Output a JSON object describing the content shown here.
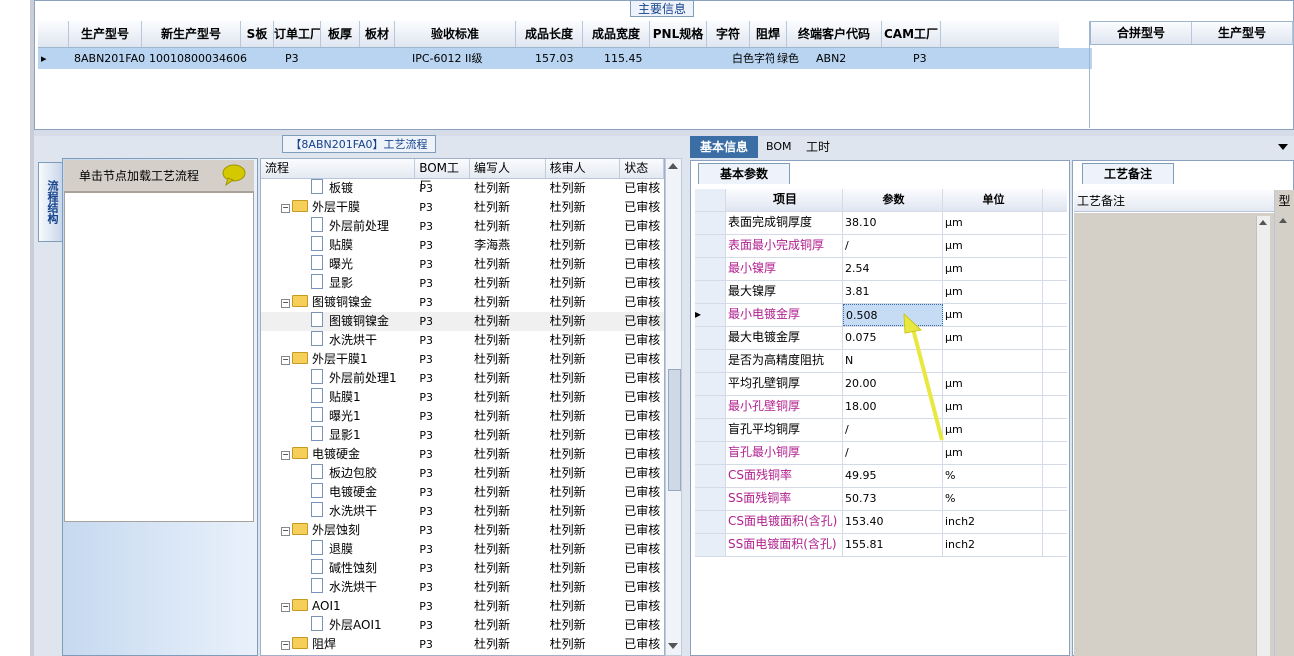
{
  "top_panel": {
    "title": "主要信息",
    "columns": [
      "生产型号",
      "新生产型号",
      "S板",
      "订单工厂",
      "板厚",
      "板材",
      "验收标准",
      "成品长度",
      "成品宽度",
      "PNL规格",
      "字符",
      "阻焊",
      "终端客户代码",
      "CAM工厂"
    ],
    "row": [
      "8ABN201FA0",
      "10010800034606",
      "",
      "P3",
      "",
      "",
      "IPC-6012 II级",
      "157.03",
      "115.45",
      "",
      "白色字符",
      "绿色",
      "ABN2",
      "P3"
    ],
    "right_columns": [
      "合拼型号",
      "生产型号"
    ]
  },
  "left_panel": {
    "tab_label": "流程结构",
    "header": "单击节点加载工艺流程"
  },
  "flow": {
    "title": "【8ABN201FA0】工艺流程",
    "columns": [
      "流程",
      "BOM工厂",
      "编写人",
      "核审人",
      "状态"
    ],
    "rows": [
      {
        "name": "板镀",
        "level": 2,
        "factory": "P3",
        "writer": "杜列新",
        "reviewer": "杜列新",
        "status": "已审核"
      },
      {
        "name": "外层干膜",
        "level": 1,
        "factory": "P3",
        "writer": "杜列新",
        "reviewer": "杜列新",
        "status": "已审核"
      },
      {
        "name": "外层前处理",
        "level": 2,
        "factory": "P3",
        "writer": "杜列新",
        "reviewer": "杜列新",
        "status": "已审核"
      },
      {
        "name": "贴膜",
        "level": 2,
        "factory": "P3",
        "writer": "李海燕",
        "reviewer": "杜列新",
        "status": "已审核"
      },
      {
        "name": "曝光",
        "level": 2,
        "factory": "P3",
        "writer": "杜列新",
        "reviewer": "杜列新",
        "status": "已审核"
      },
      {
        "name": "显影",
        "level": 2,
        "factory": "P3",
        "writer": "杜列新",
        "reviewer": "杜列新",
        "status": "已审核"
      },
      {
        "name": "图镀铜镍金",
        "level": 1,
        "factory": "P3",
        "writer": "杜列新",
        "reviewer": "杜列新",
        "status": "已审核"
      },
      {
        "name": "图镀铜镍金",
        "level": 2,
        "factory": "P3",
        "writer": "杜列新",
        "reviewer": "杜列新",
        "status": "已审核"
      },
      {
        "name": "水洗烘干",
        "level": 2,
        "factory": "P3",
        "writer": "杜列新",
        "reviewer": "杜列新",
        "status": "已审核"
      },
      {
        "name": "外层干膜1",
        "level": 1,
        "factory": "P3",
        "writer": "杜列新",
        "reviewer": "杜列新",
        "status": "已审核"
      },
      {
        "name": "外层前处理1",
        "level": 2,
        "factory": "P3",
        "writer": "杜列新",
        "reviewer": "杜列新",
        "status": "已审核"
      },
      {
        "name": "贴膜1",
        "level": 2,
        "factory": "P3",
        "writer": "杜列新",
        "reviewer": "杜列新",
        "status": "已审核"
      },
      {
        "name": "曝光1",
        "level": 2,
        "factory": "P3",
        "writer": "杜列新",
        "reviewer": "杜列新",
        "status": "已审核"
      },
      {
        "name": "显影1",
        "level": 2,
        "factory": "P3",
        "writer": "杜列新",
        "reviewer": "杜列新",
        "status": "已审核"
      },
      {
        "name": "电镀硬金",
        "level": 1,
        "factory": "P3",
        "writer": "杜列新",
        "reviewer": "杜列新",
        "status": "已审核"
      },
      {
        "name": "板边包胶",
        "level": 2,
        "factory": "P3",
        "writer": "杜列新",
        "reviewer": "杜列新",
        "status": "已审核"
      },
      {
        "name": "电镀硬金",
        "level": 2,
        "factory": "P3",
        "writer": "杜列新",
        "reviewer": "杜列新",
        "status": "已审核"
      },
      {
        "name": "水洗烘干",
        "level": 2,
        "factory": "P3",
        "writer": "杜列新",
        "reviewer": "杜列新",
        "status": "已审核"
      },
      {
        "name": "外层蚀刻",
        "level": 1,
        "factory": "P3",
        "writer": "杜列新",
        "reviewer": "杜列新",
        "status": "已审核"
      },
      {
        "name": "退膜",
        "level": 2,
        "factory": "P3",
        "writer": "杜列新",
        "reviewer": "杜列新",
        "status": "已审核"
      },
      {
        "name": "碱性蚀刻",
        "level": 2,
        "factory": "P3",
        "writer": "杜列新",
        "reviewer": "杜列新",
        "status": "已审核"
      },
      {
        "name": "水洗烘干",
        "level": 2,
        "factory": "P3",
        "writer": "杜列新",
        "reviewer": "杜列新",
        "status": "已审核"
      },
      {
        "name": "AOI1",
        "level": 1,
        "factory": "P3",
        "writer": "杜列新",
        "reviewer": "杜列新",
        "status": "已审核"
      },
      {
        "name": "外层AOI1",
        "level": 2,
        "factory": "P3",
        "writer": "杜列新",
        "reviewer": "杜列新",
        "status": "已审核"
      },
      {
        "name": "阻焊",
        "level": 1,
        "factory": "P3",
        "writer": "杜列新",
        "reviewer": "杜列新",
        "status": "已审核"
      }
    ]
  },
  "tabs": {
    "items": [
      "基本信息",
      "BOM",
      "工时"
    ],
    "active": "基本信息"
  },
  "params": {
    "subtab": "基本参数",
    "columns": [
      "项目",
      "参数",
      "单位"
    ],
    "rows": [
      {
        "item": "表面完成铜厚度",
        "value": "38.10",
        "unit": "μm",
        "highlight": false
      },
      {
        "item": "表面最小完成铜厚",
        "value": "/",
        "unit": "μm",
        "highlight": true
      },
      {
        "item": "最小镍厚",
        "value": "2.54",
        "unit": "μm",
        "highlight": true
      },
      {
        "item": "最大镍厚",
        "value": "3.81",
        "unit": "μm",
        "highlight": false
      },
      {
        "item": "最小电镀金厚",
        "value": "0.508",
        "unit": "μm",
        "highlight": true
      },
      {
        "item": "最大电镀金厚",
        "value": "0.075",
        "unit": "μm",
        "highlight": false
      },
      {
        "item": "是否为高精度阻抗",
        "value": "N",
        "unit": "",
        "highlight": false
      },
      {
        "item": "平均孔壁铜厚",
        "value": "20.00",
        "unit": "μm",
        "highlight": false
      },
      {
        "item": "最小孔壁铜厚",
        "value": "18.00",
        "unit": "μm",
        "highlight": true
      },
      {
        "item": "盲孔平均铜厚",
        "value": "/",
        "unit": "μm",
        "highlight": false
      },
      {
        "item": "盲孔最小铜厚",
        "value": "/",
        "unit": "μm",
        "highlight": true
      },
      {
        "item": "CS面残铜率",
        "value": "49.95",
        "unit": "%",
        "highlight": true
      },
      {
        "item": "SS面残铜率",
        "value": "50.73",
        "unit": "%",
        "highlight": true
      },
      {
        "item": "CS面电镀面积(含孔)",
        "value": "153.40",
        "unit": "inch2",
        "highlight": true
      },
      {
        "item": "SS面电镀面积(含孔)",
        "value": "155.81",
        "unit": "inch2",
        "highlight": true
      }
    ]
  },
  "notes": {
    "tab": "工艺备注",
    "header": "工艺备注",
    "col2": "型"
  },
  "colors": {
    "selected_row": "#b8d4f0",
    "highlight_text": "#b0208e",
    "arrow": "#e8e840"
  }
}
